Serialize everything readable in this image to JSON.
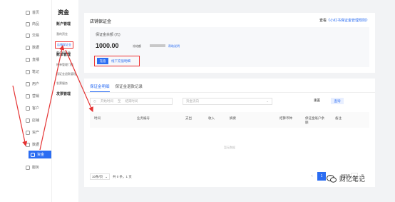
{
  "nav": {
    "items": [
      {
        "label": "首页",
        "icon": "home-icon"
      },
      {
        "label": "商品",
        "icon": "goods-icon"
      },
      {
        "label": "交易",
        "icon": "trade-icon"
      },
      {
        "label": "数据",
        "icon": "data-icon"
      },
      {
        "label": "直播",
        "icon": "live-icon"
      },
      {
        "label": "笔记",
        "icon": "note-icon"
      },
      {
        "label": "用户",
        "icon": "user-icon"
      },
      {
        "label": "营销",
        "icon": "marketing-icon"
      },
      {
        "label": "客户",
        "icon": "customer-icon"
      },
      {
        "label": "店铺",
        "icon": "store-icon"
      },
      {
        "label": "资产",
        "icon": "asset-icon"
      },
      {
        "label": "数据",
        "icon": "chart-icon"
      },
      {
        "label": "资金",
        "icon": "wallet-icon"
      },
      {
        "label": "服务",
        "icon": "service-icon"
      }
    ],
    "active_label": "资金"
  },
  "subnav": {
    "title": "资金",
    "group1": "账户管理",
    "group1_items": [
      "我的资金",
      "店铺保证金",
      "商品保证金"
    ],
    "group2": "账单管理",
    "group2_items": [
      "账单管理门槛",
      "保证金退款管理",
      "发票服务"
    ],
    "extra": "发票管理"
  },
  "deposit_card": {
    "title": "店铺保证金",
    "note_prefix": "查看",
    "note_link": "《小红书保证金管理规则》",
    "balance_label": "保证金余额 (元)",
    "balance": "1000.00",
    "frozen_label": "冻结额",
    "help_link": "帮助说明",
    "pay_button": "充值",
    "refund_link": "线下充值明细"
  },
  "detail_card": {
    "tabs": [
      "保证金明细",
      "保证金退款记录"
    ],
    "active_tab": 0,
    "start_placeholder": "开始时间",
    "separator": "至",
    "end_placeholder": "结束时间",
    "direction_placeholder": "资金流向",
    "reset_button": "重置",
    "query_button": "查询",
    "columns": [
      "时间",
      "业务编号",
      "支出",
      "收入",
      "摘要",
      "结算币种",
      "保证金账户余额",
      "备注"
    ],
    "empty_text": "暂无数据",
    "page_size": "10条/页",
    "total": "共 0 条，1 页",
    "page_prev": "<",
    "page_current": "1",
    "page_next": ">",
    "jump_label": "跳转至",
    "jump_value": "1",
    "jump_unit": "页"
  },
  "watermark": {
    "text": "财亿笔记"
  },
  "colors": {
    "accent": "#2b6df2",
    "highlight_red": "#e53333"
  }
}
